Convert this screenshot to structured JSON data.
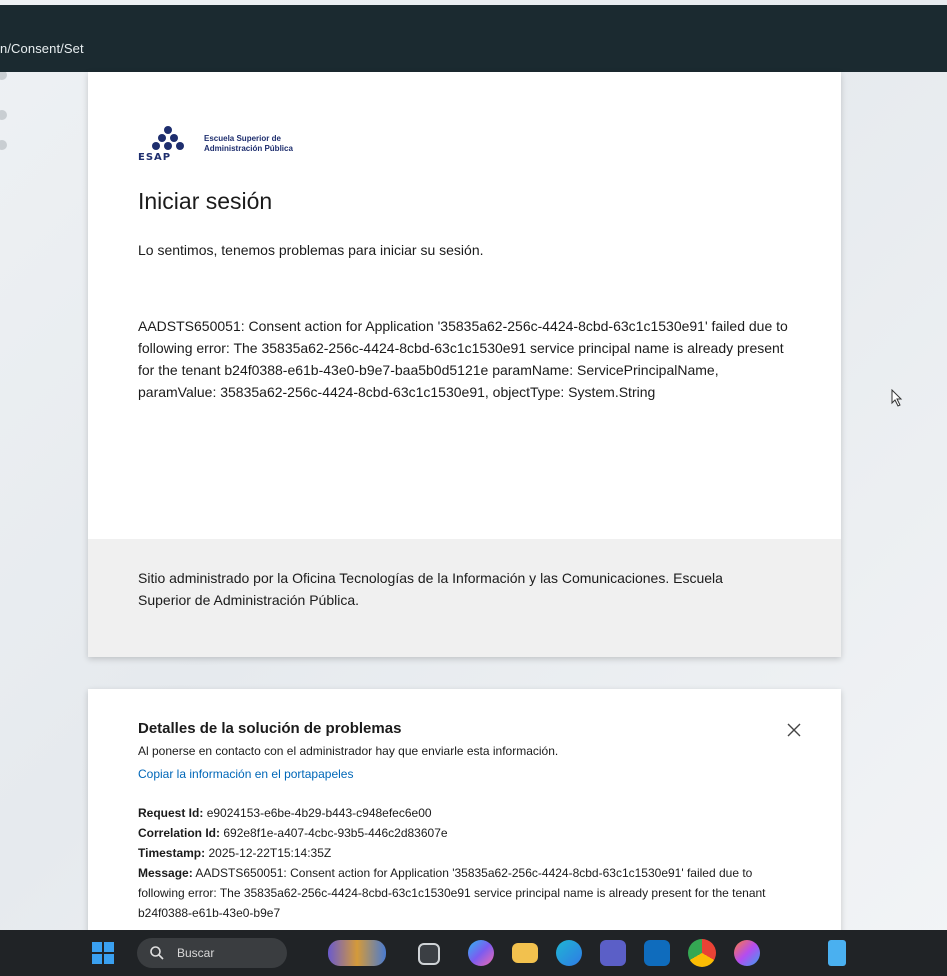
{
  "browser": {
    "url_fragment": "n/Consent/Set"
  },
  "signin_card": {
    "logo": {
      "org_line1": "Escuela Superior de",
      "org_line2": "Administración Pública",
      "acronym": "ESAP"
    },
    "title": "Iniciar sesión",
    "subtitle": "Lo sentimos, tenemos problemas para iniciar su sesión.",
    "error_message": "AADSTS650051: Consent action for Application '35835a62-256c-4424-8cbd-63c1c1530e91' failed due to following error: The 35835a62-256c-4424-8cbd-63c1c1530e91 service principal name is already present for the tenant b24f0388-e61b-43e0-b9e7-baa5b0d5121e paramName: ServicePrincipalName, paramValue: 35835a62-256c-4424-8cbd-63c1c1530e91, objectType: System.String",
    "footer_text": "Sitio administrado por la Oficina Tecnologías de la Información y las Comunicaciones. Escuela Superior de Administración Pública."
  },
  "details_card": {
    "title": "Detalles de la solución de problemas",
    "note": "Al ponerse en contacto con el administrador hay que enviarle esta información.",
    "copy_link": "Copiar la información en el portapapeles",
    "fields": {
      "request_id_label": "Request Id:",
      "request_id_value": "e9024153-e6be-4b29-b443-c948efec6e00",
      "correlation_id_label": "Correlation Id:",
      "correlation_id_value": "692e8f1e-a407-4cbc-93b5-446c2d83607e",
      "timestamp_label": "Timestamp:",
      "timestamp_value": "2025-12-22T15:14:35Z",
      "message_label": "Message:",
      "message_value": "AADSTS650051: Consent action for Application '35835a62-256c-4424-8cbd-63c1c1530e91' failed due to following error: The 35835a62-256c-4424-8cbd-63c1c1530e91 service principal name is already present for the tenant b24f0388-e61b-43e0-b9e7"
    }
  },
  "taskbar": {
    "search_placeholder": "Buscar",
    "icons": [
      "windows-start-icon",
      "search-icon",
      "task-view-icon",
      "copilot-icon",
      "file-explorer-icon",
      "edge-icon",
      "teams-icon",
      "outlook-icon",
      "chrome-icon",
      "copilot-app-icon",
      "notepad-icon"
    ]
  },
  "colors": {
    "topbar": "#1b2a30",
    "link": "#0067b8",
    "taskbar": "#202326",
    "footer_bg": "#f0f0f0"
  }
}
